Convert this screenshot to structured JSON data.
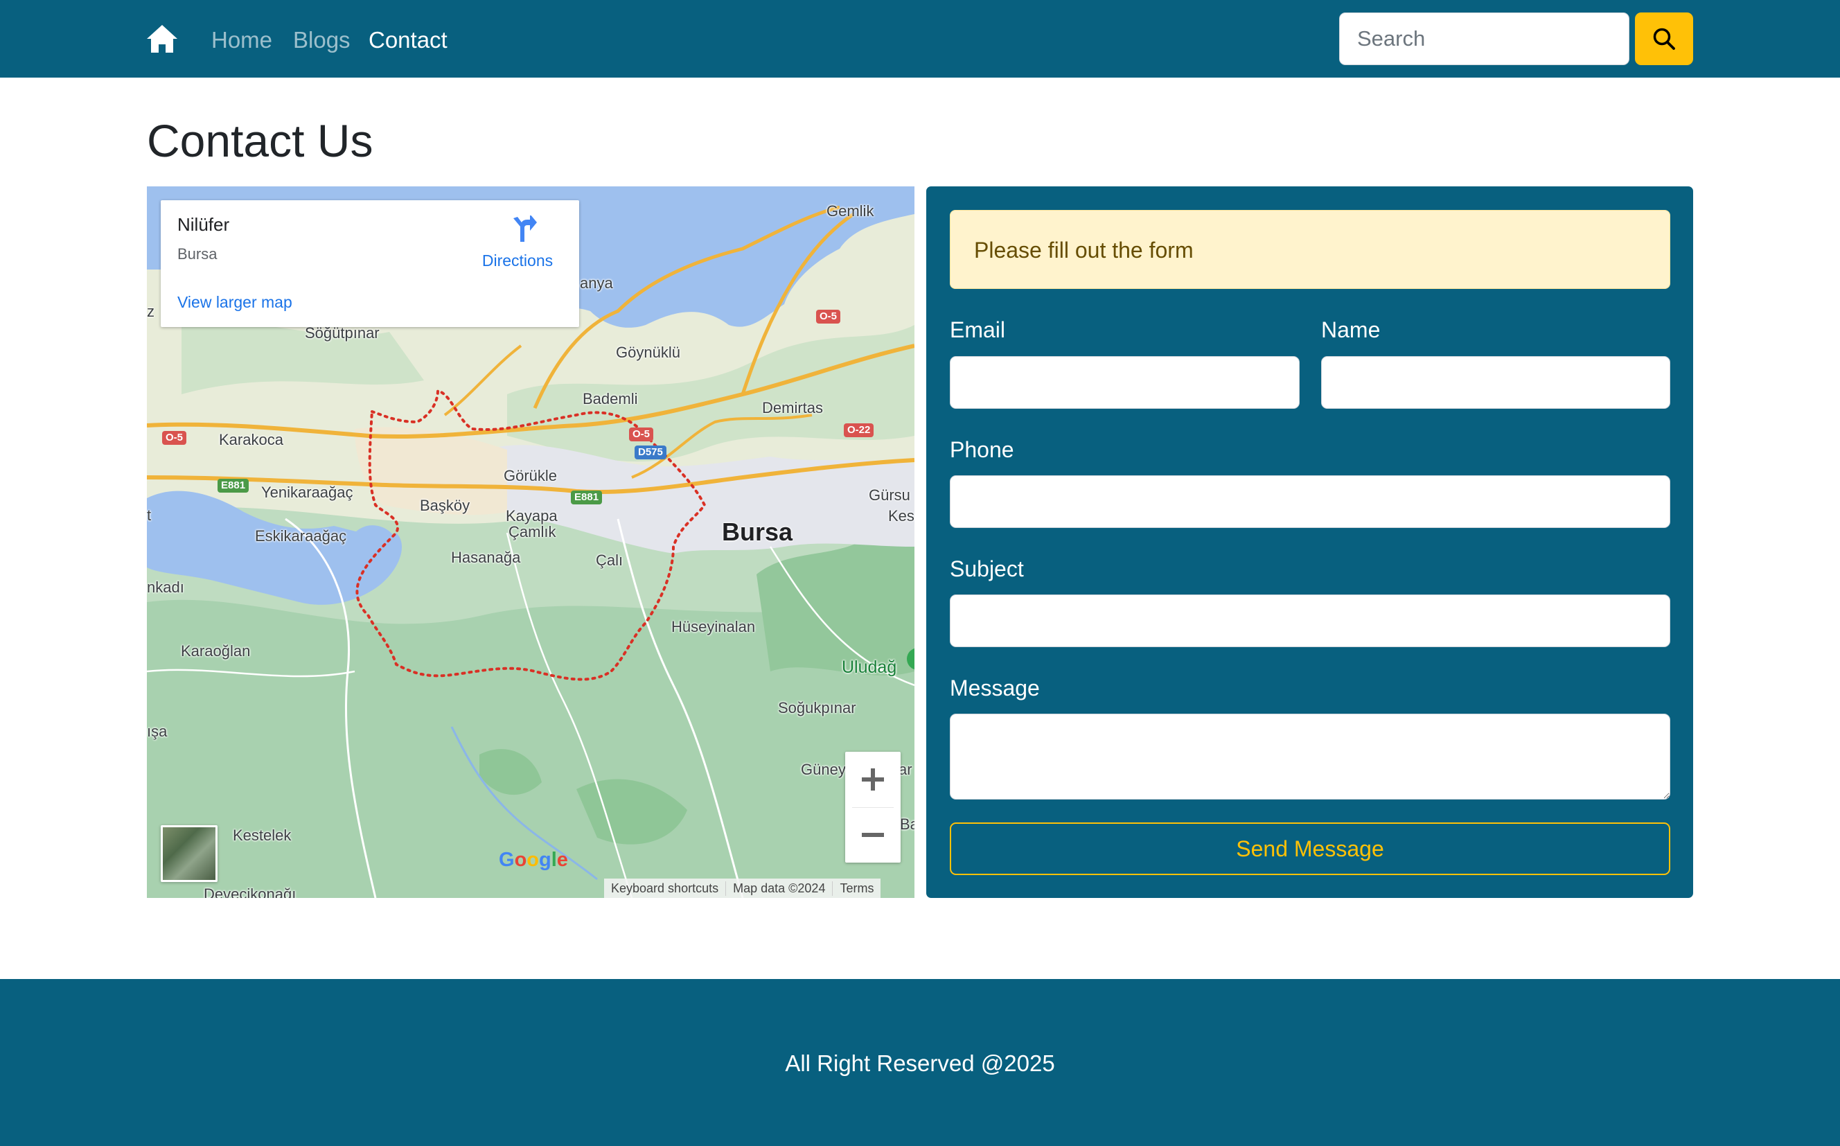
{
  "navbar": {
    "home_icon": "house-icon",
    "links": [
      {
        "label": "Home",
        "active": false
      },
      {
        "label": "Blogs",
        "active": false
      },
      {
        "label": "Contact",
        "active": true
      }
    ],
    "search_placeholder": "Search",
    "search_button_icon": "search-icon"
  },
  "page": {
    "title": "Contact Us"
  },
  "map": {
    "place_name": "Nilüfer",
    "place_region": "Bursa",
    "directions_label": "Directions",
    "view_larger_label": "View larger map",
    "places": {
      "bursa": "Bursa",
      "gemlik": "Gemlik",
      "mudanya": "anya",
      "sogutpinar": "Söğütpınar",
      "goynuklu": "Göynüklü",
      "bademli": "Bademli",
      "demirtas": "Demirtas",
      "karakoca": "Karakoca",
      "yenikaraagac": "Yenikaraağaç",
      "gorukle": "Görükle",
      "baskoy": "Başköy",
      "kayapa": "Kayapa",
      "camlik": "Çamlık",
      "eskikaraagac": "Eskikaraağaç",
      "hasanaga": "Hasanağa",
      "cali": "Çalı",
      "gursu": "Gürsu",
      "kestel_partial": "Kes",
      "nkadi": "nkadı",
      "huseyinalan": "Hüseyinalan",
      "karaoglan": "Karaoğlan",
      "uludag": "Uludağ",
      "sogukpinar": "Soğukpınar",
      "sa": "ışa",
      "guney": "Güney",
      "ar": "ar",
      "ba": "Ba",
      "kestelek": "Kestelek",
      "devecikonagi": "Devecikonağı",
      "z": "z",
      "t": "t"
    },
    "shields": {
      "o5_top": "O-5",
      "o5_left": "O-5",
      "o5_mid": "O-5",
      "o22": "O-22",
      "d575": "D575",
      "e881_left": "E881",
      "e881_mid": "E881"
    },
    "google_logo": "Google",
    "attribution": [
      "Keyboard shortcuts",
      "Map data ©2024",
      "Terms"
    ]
  },
  "form": {
    "alert": "Please fill out the form",
    "email_label": "Email",
    "name_label": "Name",
    "phone_label": "Phone",
    "subject_label": "Subject",
    "message_label": "Message",
    "send_label": "Send Message"
  },
  "footer": {
    "text": "All Right Reserved @2025"
  },
  "colors": {
    "primary": "#08607f",
    "accent": "#ffc107",
    "alert_bg": "#fff3cd",
    "alert_text": "#664d03"
  }
}
